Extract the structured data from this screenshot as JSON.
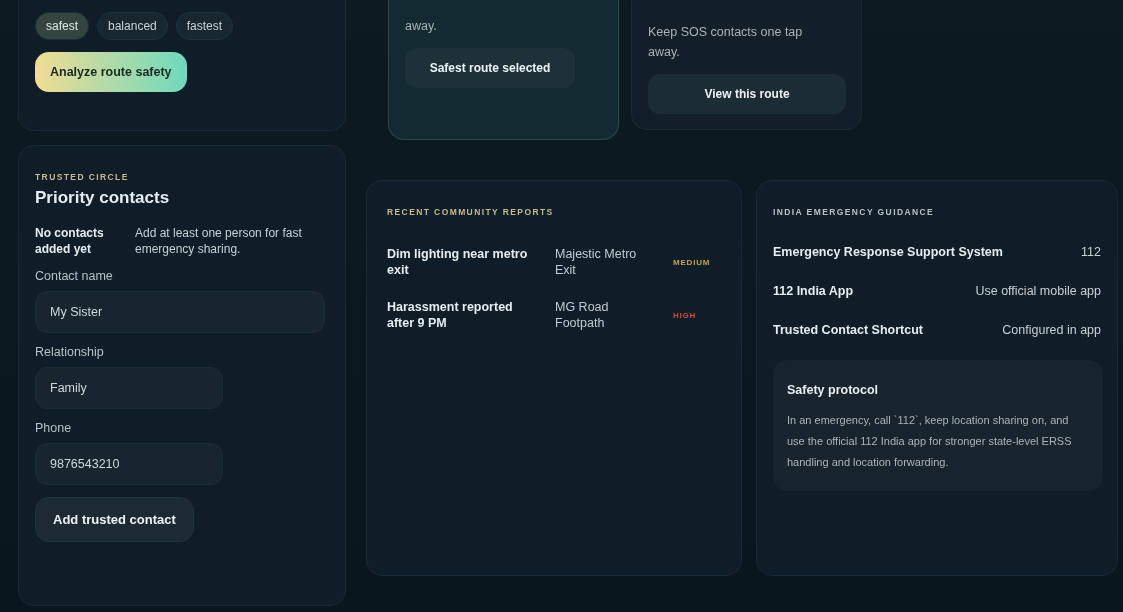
{
  "route_modes": [
    {
      "label": "safest",
      "selected": true
    },
    {
      "label": "balanced",
      "selected": false
    },
    {
      "label": "fastest",
      "selected": false
    }
  ],
  "analyze_button": "Analyze route safety",
  "route_cards": [
    {
      "text": "away.",
      "button": "Safest route selected",
      "selected": true
    },
    {
      "text": "Keep SOS contacts one tap away.",
      "button": "View this route",
      "selected": false
    }
  ],
  "trusted_circle": {
    "eyebrow": "TRUSTED CIRCLE",
    "title": "Priority contacts",
    "empty_title": "No contacts added yet",
    "empty_text": "Add at least one person for fast emergency sharing.",
    "fields": [
      {
        "label": "Contact name",
        "value": "My Sister"
      },
      {
        "label": "Relationship",
        "value": "Family"
      },
      {
        "label": "Phone",
        "value": "9876543210"
      }
    ],
    "add_button": "Add trusted contact"
  },
  "community_reports": {
    "eyebrow": "RECENT COMMUNITY REPORTS",
    "rows": [
      {
        "title": "Dim lighting near metro exit",
        "location": "Majestic Metro Exit",
        "severity": "MEDIUM",
        "color": "#c9a24a"
      },
      {
        "title": "Harassment reported after 9 PM",
        "location": "MG Road Footpath",
        "severity": "HIGH",
        "color": "#c8503f"
      }
    ]
  },
  "emergency_guidance": {
    "eyebrow": "INDIA EMERGENCY GUIDANCE",
    "rows": [
      {
        "label": "Emergency Response Support System",
        "value": "112"
      },
      {
        "label": "112 India App",
        "value": "Use official mobile app"
      },
      {
        "label": "Trusted Contact Shortcut",
        "value": "Configured in app"
      }
    ],
    "protocol": {
      "title": "Safety protocol",
      "text": "In an emergency, call `112`, keep location sharing on, and use the official 112 India app for stronger state-level ERSS handling and location forwarding."
    }
  }
}
